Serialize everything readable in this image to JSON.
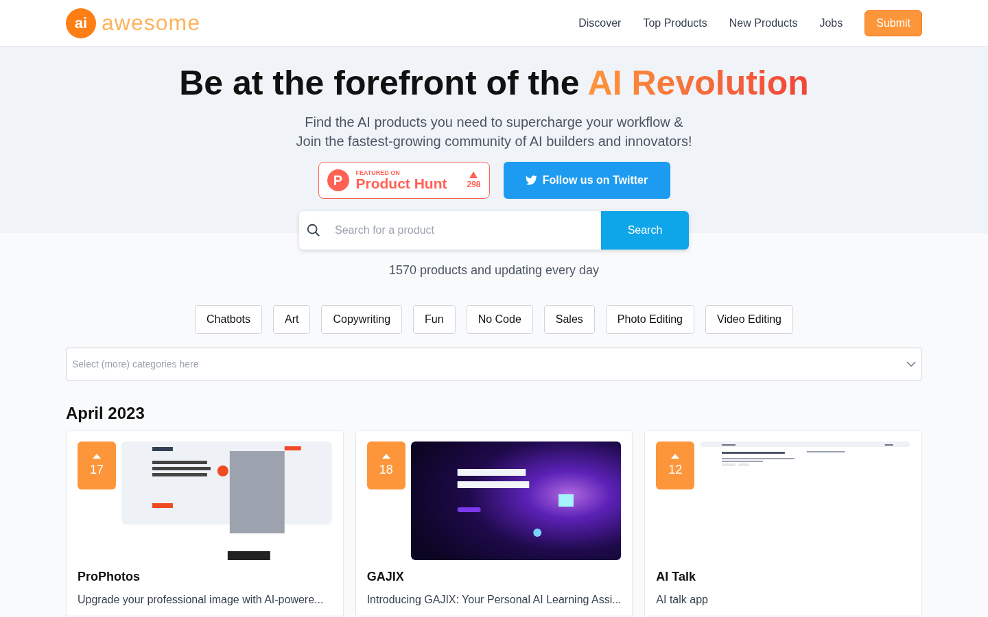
{
  "header": {
    "logo": {
      "mark": "ai",
      "word": "awesome"
    },
    "nav": [
      "Discover",
      "Top Products",
      "New Products",
      "Jobs"
    ],
    "submit": "Submit"
  },
  "hero": {
    "title_lead": "Be at the forefront of the ",
    "title_highlight": "AI Revolution",
    "subtitle": [
      "Find the AI products you need to supercharge your workflow &",
      "Join the fastest-growing community of AI builders and innovators!"
    ],
    "product_hunt": {
      "letter": "P",
      "featured": "FEATURED ON",
      "name": "Product Hunt",
      "votes": "298"
    },
    "twitter": "Follow us on Twitter"
  },
  "search": {
    "placeholder": "Search for a product",
    "button": "Search"
  },
  "count": "1570 products and updating every day",
  "categories": [
    "Chatbots",
    "Art",
    "Copywriting",
    "Fun",
    "No Code",
    "Sales",
    "Photo Editing",
    "Video Editing"
  ],
  "category_select": {
    "placeholder": "Select (more) categories here"
  },
  "section_title": "April 2023",
  "products": [
    {
      "votes": "17",
      "name": "ProPhotos",
      "description": "Upgrade your professional image with AI-powere...",
      "kind": "light"
    },
    {
      "votes": "18",
      "name": "GAJIX",
      "description": "Introducing GAJIX: Your Personal AI Learning Assi...",
      "kind": "dark"
    },
    {
      "votes": "12",
      "name": "AI Talk",
      "description": "AI talk app",
      "kind": "plain"
    }
  ]
}
